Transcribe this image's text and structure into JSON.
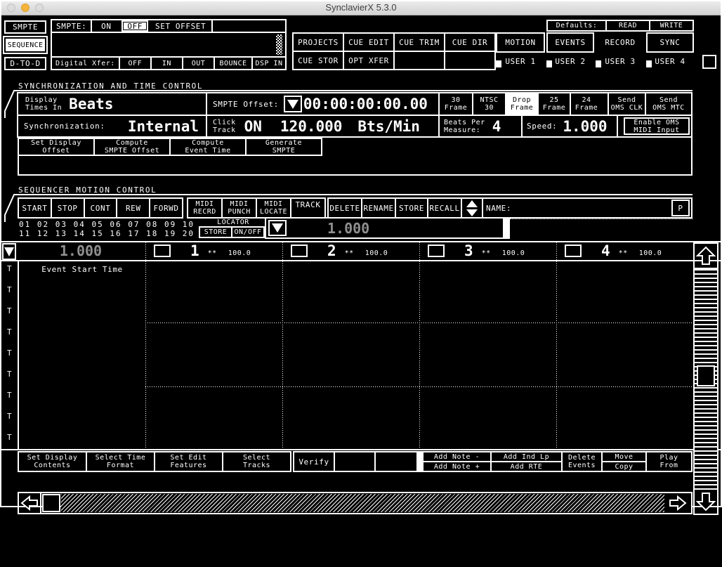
{
  "window": {
    "title": "SynclavierX 5.3.0"
  },
  "nav": {
    "smpte": "SMPTE",
    "sequence": "SEQUENCE",
    "dtod": "D-TO-D"
  },
  "smpte_panel": {
    "label": "SMPTE:",
    "on": "ON",
    "off": "OFF",
    "set_offset": "SET OFFSET",
    "xfer_label": "Digital Xfer:",
    "xfer_off": "OFF",
    "xfer_in": "IN",
    "xfer_out": "OUT",
    "xfer_bounce": "BOUNCE",
    "xfer_dsp": "DSP IN"
  },
  "defaults": {
    "label": "Defaults:",
    "read": "READ",
    "write": "WRITE"
  },
  "modes": {
    "projects": "PROJECTS",
    "cue_edit": "CUE EDIT",
    "cue_trim": "CUE TRIM",
    "cue_dir": "CUE DIR",
    "cue_stor": "CUE STOR",
    "opt_xfer": "OPT XFER",
    "motion": "MOTION",
    "events": "EVENTS",
    "record": "RECORD",
    "sync": "SYNC",
    "user1": "USER 1",
    "user2": "USER 2",
    "user3": "USER 3",
    "user4": "USER 4"
  },
  "sync_section": {
    "title": "SYNCHRONIZATION AND TIME CONTROL",
    "display_times_label": "Display\nTimes In",
    "display_times_value": "Beats",
    "smpte_offset_label": "SMPTE Offset:",
    "smpte_offset_value": "00:00:00:00.00",
    "frame_buttons": [
      "30\nFrame",
      "NTSC\n30",
      "Drop\nFrame",
      "25\nFrame",
      "24\nFrame"
    ],
    "send_clk": "Send\nOMS CLK",
    "send_mtc": "Send\nOMS MTC",
    "sync_label": "Synchronization:",
    "sync_value": "Internal",
    "click_label": "Click\nTrack",
    "click_state": "ON",
    "tempo": "120.000",
    "tempo_unit": "Bts/Min",
    "bpm_label": "Beats Per\nMeasure:",
    "bpm_value": "4",
    "speed_label": "Speed:",
    "speed_value": "1.000",
    "enable_oms": "Enable OMS\nMIDI Input",
    "btn_set_display_offset": "Set Display\nOffset",
    "btn_compute_smpte": "Compute\nSMPTE Offset",
    "btn_compute_event": "Compute\nEvent Time",
    "btn_generate_smpte": "Generate\nSMPTE"
  },
  "motion_section": {
    "title": "SEQUENCER MOTION CONTROL",
    "start": "START",
    "stop": "STOP",
    "cont": "CONT",
    "rew": "REW",
    "forwd": "FORWD",
    "midi_recrd": "MIDI\nRECRD",
    "midi_punch": "MIDI\nPUNCH",
    "midi_locate": "MIDI\nLOCATE",
    "track": "TRACK",
    "delete": "DELETE",
    "rename": "RENAME",
    "store": "STORE",
    "recall": "RECALL",
    "name_label": "NAME:",
    "p_button": "P",
    "track_numbers_row1": "01 02 03 04 05 06 07 08 09 10",
    "track_numbers_row2": "11 12 13 14 15 16 17 18 19 20",
    "locator_label": "LOCATOR",
    "locator_store": "STORE",
    "locator_onoff": "ON/OFF",
    "locator_value": "1.000"
  },
  "grid": {
    "position_value": "1.000",
    "row_label": "Event Start Time",
    "row_marker": "T",
    "tracks": [
      {
        "num": "1",
        "stars": "**",
        "level": "100.0"
      },
      {
        "num": "2",
        "stars": "**",
        "level": "100.0"
      },
      {
        "num": "3",
        "stars": "**",
        "level": "100.0"
      },
      {
        "num": "4",
        "stars": "**",
        "level": "100.0"
      }
    ]
  },
  "bottom_bar": {
    "set_display_contents": "Set Display\nContents",
    "select_time_format": "Select Time\nFormat",
    "set_edit_features": "Set Edit\nFeatures",
    "select_tracks": "Select\nTracks",
    "verify": "Verify",
    "add_note_minus": "Add Note -",
    "add_note_plus": "Add Note +",
    "add_ind_lp": "Add Ind Lp",
    "add_rte": "Add RTE",
    "delete_events": "Delete\nEvents",
    "move": "Move",
    "copy": "Copy",
    "play_from": "Play\nFrom"
  },
  "colors": {
    "bg": "#000000",
    "fg": "#ffffff",
    "accent_inverted": "#ffffff",
    "dim_value": "#8f8f8f",
    "titlebar_yellow": "#f5b43d"
  }
}
